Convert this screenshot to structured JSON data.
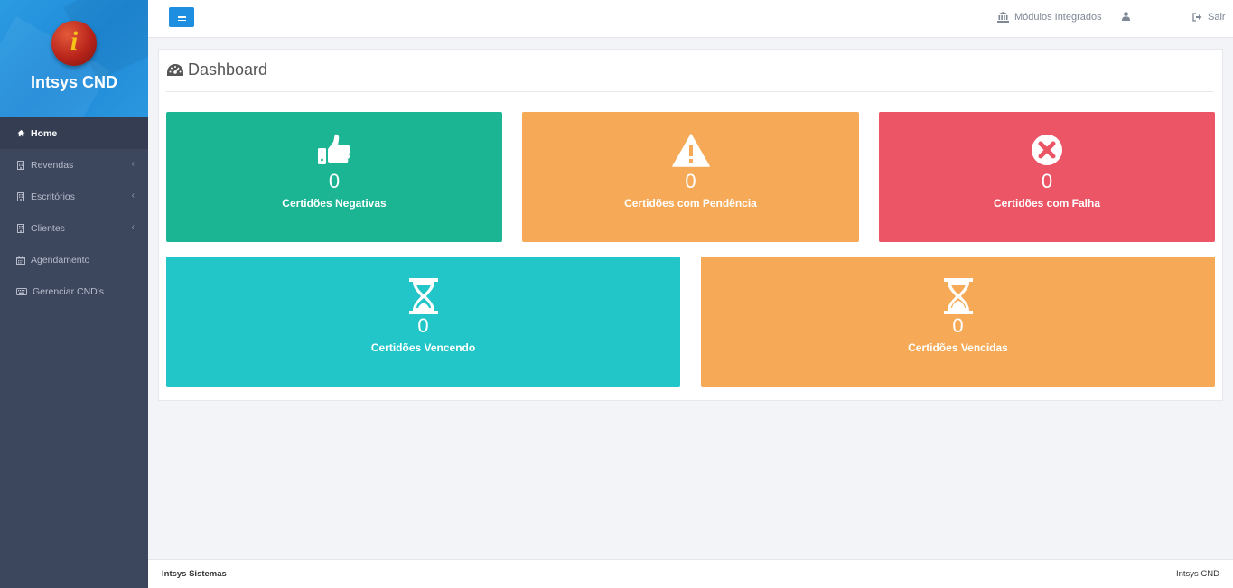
{
  "brand": {
    "name": "Intsys CND",
    "logo_letter": "i"
  },
  "sidebar": {
    "items": [
      {
        "label": "Home",
        "icon": "home-icon"
      },
      {
        "label": "Revendas",
        "icon": "building-icon"
      },
      {
        "label": "Escritórios",
        "icon": "building-icon"
      },
      {
        "label": "Clientes",
        "icon": "building-icon"
      },
      {
        "label": "Agendamento",
        "icon": "calendar-icon"
      },
      {
        "label": "Gerenciar CND's",
        "icon": "keyboard-icon"
      }
    ]
  },
  "topbar": {
    "modules_label": "Módulos Integrados",
    "logout_label": "Sair"
  },
  "dashboard": {
    "title": "Dashboard",
    "cards": [
      {
        "count": "0",
        "label": "Certidões Negativas",
        "icon": "thumbs-up-icon",
        "color": "#1bb594"
      },
      {
        "count": "0",
        "label": "Certidões com Pendência",
        "icon": "warning-icon",
        "color": "#f6aa57"
      },
      {
        "count": "0",
        "label": "Certidões com Falha",
        "icon": "times-circle-icon",
        "color": "#ec5565"
      },
      {
        "count": "0",
        "label": "Certidões Vencendo",
        "icon": "hourglass-icon",
        "color": "#23c6c8"
      },
      {
        "count": "0",
        "label": "Certidões Vencidas",
        "icon": "hourglass-icon",
        "color": "#f6aa57"
      }
    ]
  },
  "footer": {
    "left": "Intsys Sistemas",
    "right": "Intsys CND"
  },
  "colors": {
    "sidebar": "#3c465d",
    "accent": "#1e8fe0"
  }
}
